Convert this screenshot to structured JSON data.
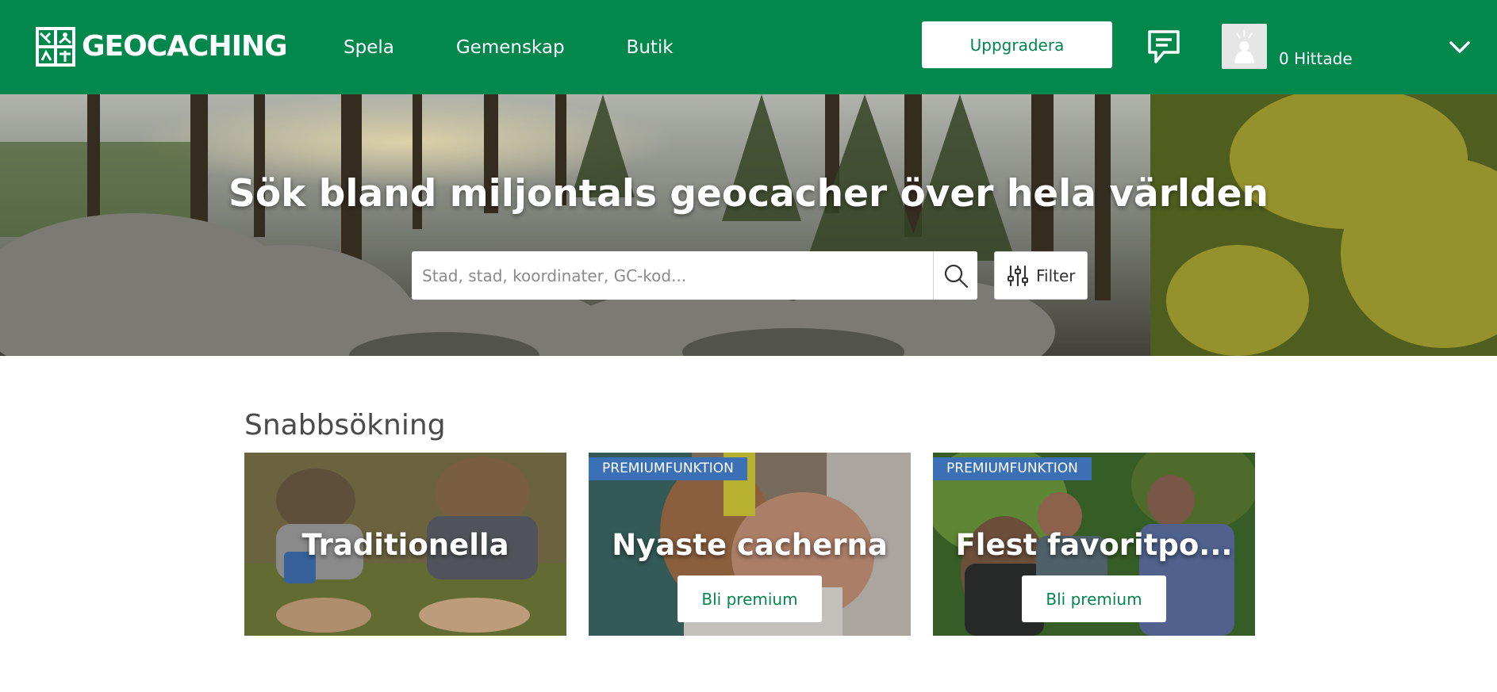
{
  "header": {
    "logo_text": "GEOCACHING",
    "nav": [
      {
        "label": "Spela"
      },
      {
        "label": "Gemenskap"
      },
      {
        "label": "Butik"
      }
    ],
    "upgrade_label": "Uppgradera",
    "finds_label": "0 Hittade",
    "icons": [
      "logo-icon",
      "message-icon",
      "avatar-icon",
      "chevron-down-icon"
    ]
  },
  "hero": {
    "title": "Sök bland miljontals geocacher över hela världen",
    "search_placeholder": "Stad, stad, koordinater, GC-kod...",
    "filter_label": "Filter",
    "icons": [
      "search-icon",
      "sliders-icon"
    ]
  },
  "quick_search": {
    "title": "Snabbsökning",
    "cards": [
      {
        "title": "Traditionella"
      },
      {
        "title": "Nyaste cacherna",
        "badge": "PREMIUMFUNKTION",
        "button": "Bli premium"
      },
      {
        "title": "Flest favoritpo...",
        "badge": "PREMIUMFUNKTION",
        "button": "Bli premium"
      }
    ]
  },
  "colors": {
    "brand_green": "#02874d",
    "badge_blue": "#3b6fb6",
    "heading_text": "#4a4a4a",
    "white": "#ffffff"
  }
}
